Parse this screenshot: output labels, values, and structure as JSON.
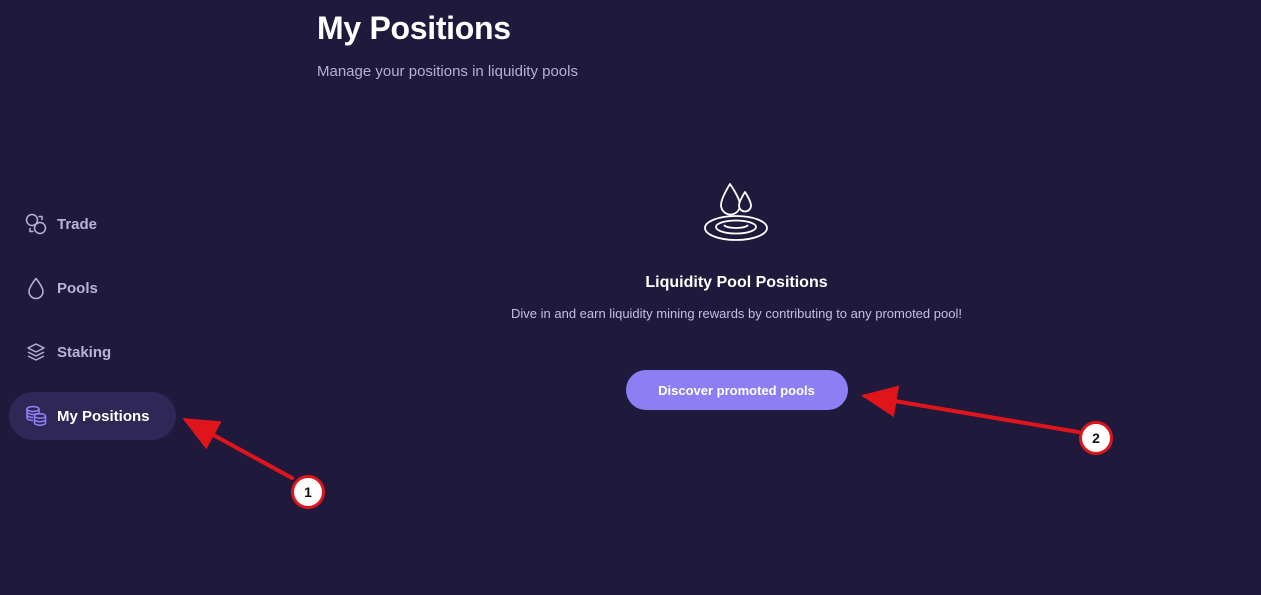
{
  "header": {
    "title": "My Positions",
    "subtitle": "Manage your positions in liquidity pools"
  },
  "sidebar": {
    "items": [
      {
        "label": "Trade",
        "icon": "trade-icon",
        "active": false
      },
      {
        "label": "Pools",
        "icon": "droplet-icon",
        "active": false
      },
      {
        "label": "Staking",
        "icon": "layers-icon",
        "active": false
      },
      {
        "label": "My Positions",
        "icon": "coins-stack-icon",
        "active": true
      }
    ]
  },
  "empty_state": {
    "icon": "liquidity-drops-icon",
    "title": "Liquidity Pool Positions",
    "description": "Dive in and earn liquidity mining rewards by contributing to any promoted pool!",
    "button_label": "Discover promoted pools"
  },
  "annotations": {
    "badge_1": "1",
    "badge_2": "2"
  },
  "colors": {
    "background": "#1f1a3c",
    "active_nav": "#2f2857",
    "accent": "#8d7ef4",
    "annotation_red": "#e0151c"
  }
}
